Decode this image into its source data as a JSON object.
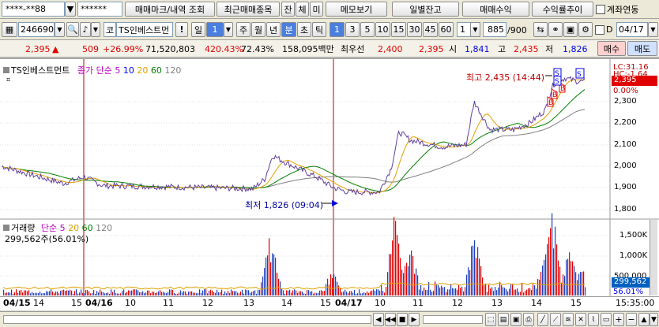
{
  "toolbar1": {
    "account": "****-**88",
    "password": "******",
    "btn_trade_marks": "매매마크/내역 조회",
    "btn_recent": "최근매매종목",
    "btn_jan": "잔",
    "btn_che": "체",
    "btn_mi": "미",
    "btn_memo": "메모보기",
    "btn_daily_balance": "일별잔고",
    "btn_trade_profit": "매매수익",
    "btn_return_trend": "수익률추이",
    "link_label": "계좌연동"
  },
  "toolbar2": {
    "stock_code": "246690",
    "stock_prefix": "코",
    "stock_name": "TS인베스트먼",
    "period_il": "일",
    "period_num": "1",
    "period_ju": "주",
    "period_wol": "월",
    "period_nyeon": "년",
    "period_bun": "분",
    "period_cho": "초",
    "period_tik": "틱",
    "intervals": [
      "1",
      "3",
      "5",
      "10",
      "15",
      "30",
      "45",
      "60"
    ],
    "interval_select": "1",
    "count": "885",
    "count_total": "/900",
    "d_label": "D",
    "date_value": "04/17"
  },
  "quote": {
    "price": "2,395",
    "arrow": "▲",
    "change": "509",
    "change_pct": "+26.99%",
    "volume": "71,520,803",
    "vol_ratio": "420.43%",
    "turnover": "72.43%",
    "amount": "158,095백만",
    "label_preferred": "최우선",
    "ask": "2,400",
    "bid": "2,395",
    "open_label": "시",
    "open": "1,841",
    "high_label": "고",
    "high": "2,435",
    "low_label": "저",
    "low": "1,826",
    "buy_label": "매수",
    "sell_label": "매도"
  },
  "price_panel": {
    "title": "TS인베스트먼트",
    "ma_label": "종가 단순",
    "ma_periods": [
      "5",
      "10",
      "20",
      "60",
      "120"
    ],
    "lc_label": "LC:31.16",
    "hc_label": "HC:-1.64",
    "current_price_tag": "2,395",
    "current_pct_tag": "0.00%",
    "y_ticks": [
      "2,300",
      "2,200",
      "2,100",
      "2,000",
      "1,900",
      "1,800"
    ],
    "high_annotation": "최고 2,435 (14:44)",
    "low_annotation": "최저 1,826 (09:04)",
    "markers": [
      "B",
      "B",
      "B",
      "S",
      "S",
      "S"
    ]
  },
  "volume_panel": {
    "title": "거래량",
    "ma_label": "단순",
    "ma_periods": [
      "5",
      "20",
      "60",
      "120"
    ],
    "value_label": "299,562주(56.01%)",
    "y_ticks": [
      "1,500K",
      "1,000K",
      "500,000"
    ],
    "current_tag": "299,562",
    "pct_tag": "56.01%"
  },
  "x_axis": {
    "labels": [
      "04/15",
      "14",
      "15",
      "04/16",
      "10",
      "11",
      "12",
      "13",
      "14",
      "15",
      "04/17",
      "10",
      "11",
      "12",
      "13",
      "14",
      "15"
    ],
    "time": "15:35:00"
  },
  "colors": {
    "up": "#e00000",
    "down": "#0000e0",
    "ma5": "#c000c0",
    "ma10": "#0000ff",
    "ma20": "#e0a000",
    "ma60": "#008000",
    "ma120": "#808080"
  }
}
